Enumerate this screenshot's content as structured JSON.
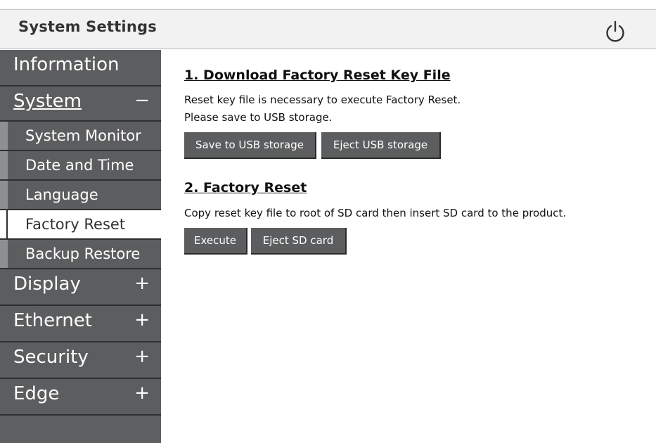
{
  "header": {
    "title": "System Settings",
    "power_icon": "power-icon"
  },
  "sidebar": {
    "items": [
      {
        "label": "Information",
        "sign": ""
      },
      {
        "label": "System",
        "sign": "−"
      },
      {
        "label": "Display",
        "sign": "+"
      },
      {
        "label": "Ethernet",
        "sign": "+"
      },
      {
        "label": "Security",
        "sign": "+"
      },
      {
        "label": "Edge",
        "sign": "+"
      }
    ],
    "system_subitems": [
      {
        "label": "System Monitor"
      },
      {
        "label": "Date and Time"
      },
      {
        "label": "Language"
      },
      {
        "label": "Factory Reset"
      },
      {
        "label": "Backup Restore"
      }
    ],
    "active_subitem": "Factory Reset"
  },
  "main": {
    "section1": {
      "heading": "1. Download Factory Reset Key File",
      "line1": "Reset key file is necessary to execute Factory Reset.",
      "line2": "Please save to USB storage.",
      "save_button": "Save to USB storage",
      "eject_button": "Eject USB storage"
    },
    "section2": {
      "heading": "2. Factory Reset",
      "line1": "Copy reset key file to root of SD card then insert SD card to the product.",
      "execute_button": "Execute",
      "eject_button": "Eject SD card"
    }
  },
  "colors": {
    "sidebar_bg": "#5c5d5e",
    "sidebar_divider": "#2f3030",
    "sub_bar": "#8e8f90",
    "header_bg": "#f2f2f2",
    "button_bg": "#5c5d5e"
  }
}
